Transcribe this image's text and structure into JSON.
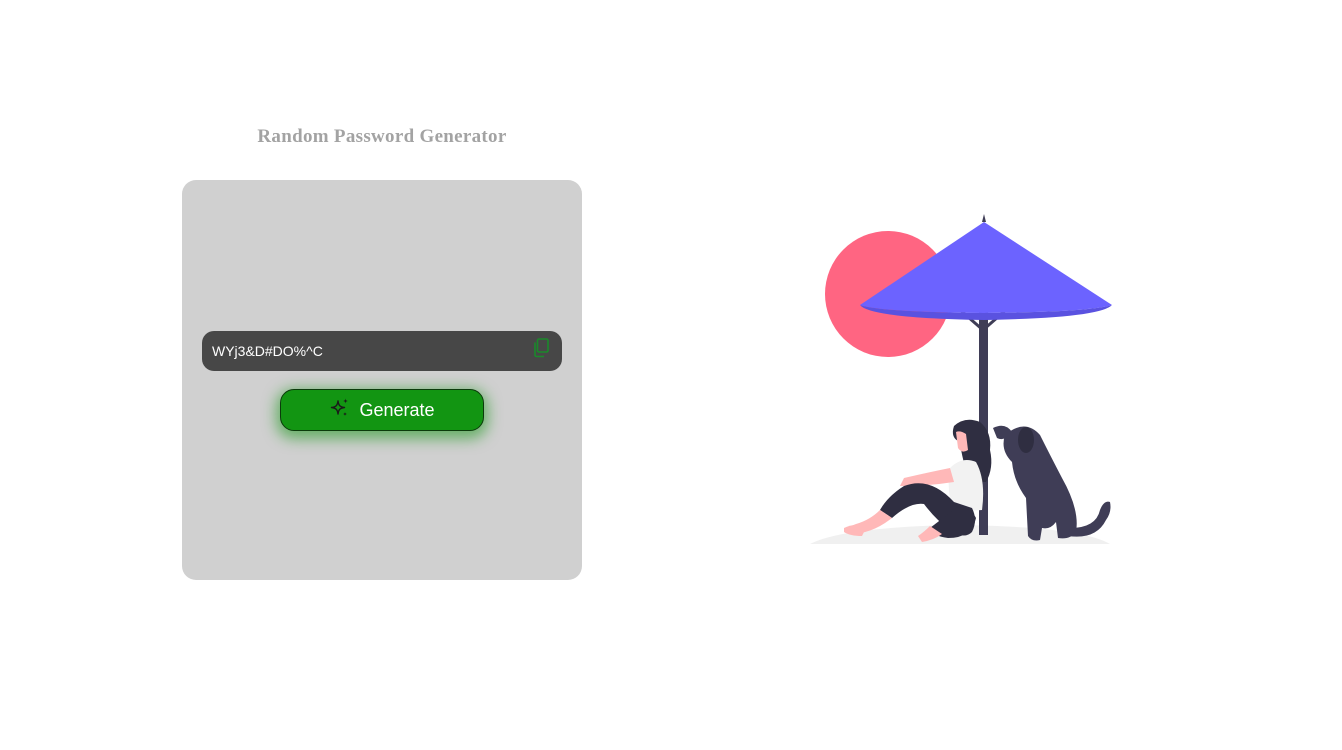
{
  "app": {
    "title": "Random Password Generator"
  },
  "password": {
    "value": "WYj3&D#DO%^C",
    "copy_icon": "copy-icon"
  },
  "generate": {
    "label": "Generate",
    "icon": "sparkles-icon"
  },
  "colors": {
    "card_background": "#d0d0d0",
    "field_background": "#474747",
    "button_green": "#129512",
    "copy_icon_green": "#1a8a2a",
    "title_gray": "#a3a3a3",
    "umbrella": "#6c63ff",
    "sun": "#ff6582",
    "dark_figure": "#3f3d56"
  }
}
